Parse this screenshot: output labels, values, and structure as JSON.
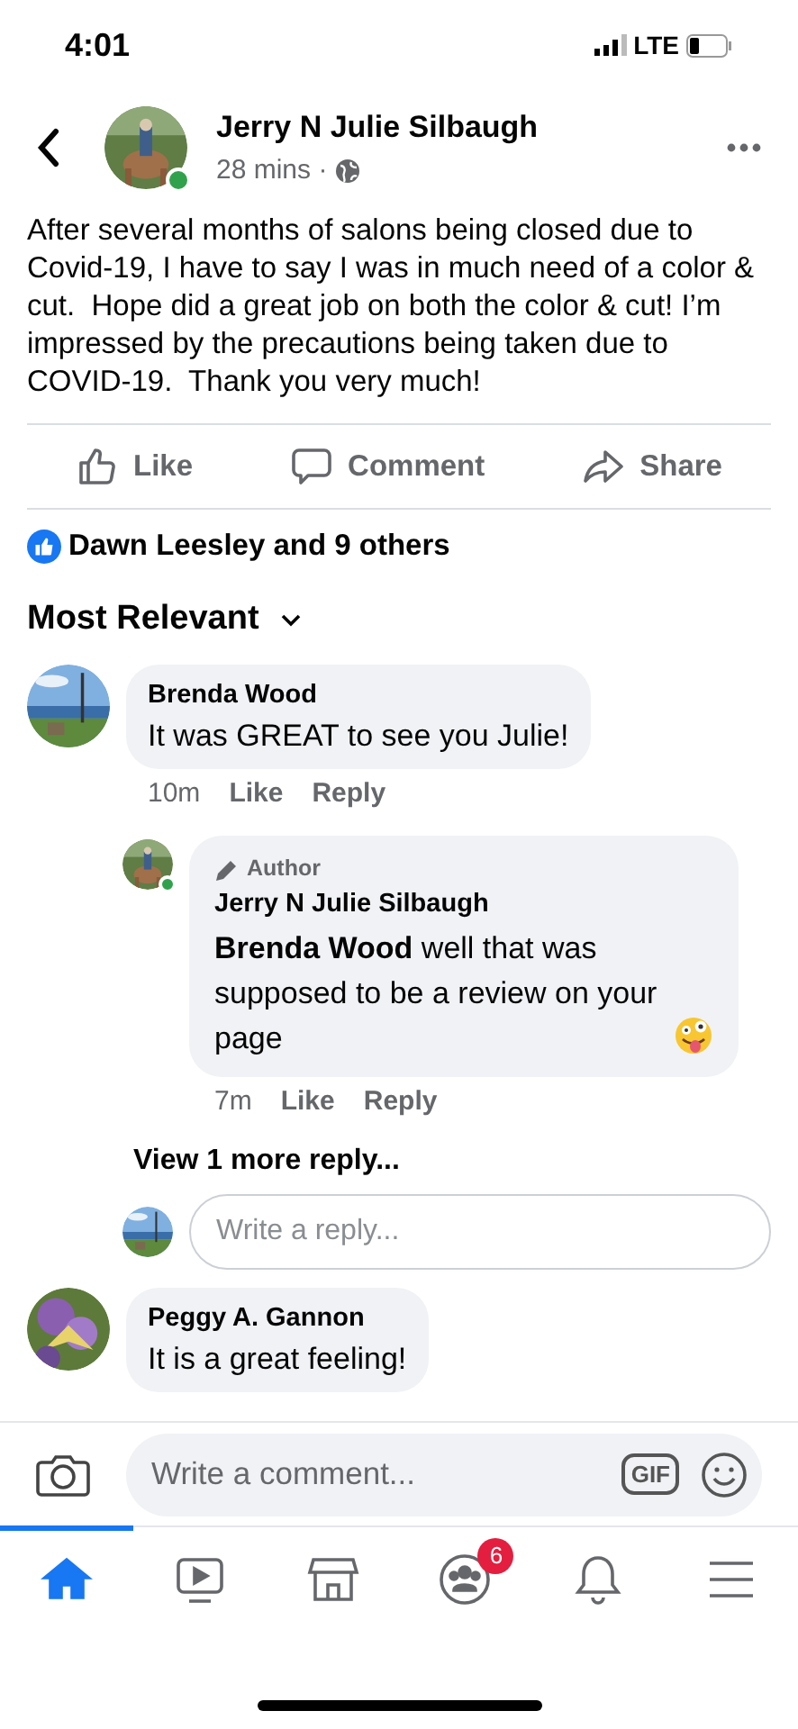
{
  "status_bar": {
    "time": "4:01",
    "network": "LTE"
  },
  "post": {
    "author": "Jerry N Julie Silbaugh",
    "online": true,
    "time": "28 mins ·",
    "body": "After several months of salons being closed due to Covid-19, I have to say I was in much need of a color & cut.  Hope did a great job on both the color & cut! I’m impressed by the precautions being taken due to COVID-19.  Thank you very much!"
  },
  "actions": [
    {
      "kind": "like",
      "label": "Like"
    },
    {
      "kind": "comment",
      "label": "Comment"
    },
    {
      "kind": "share",
      "label": "Share"
    }
  ],
  "reactions": "Dawn Leesley and 9 others",
  "sort": "Most Relevant",
  "comments": [
    {
      "author": "Brenda Wood",
      "text": "It was GREAT to see you Julie!",
      "time": "10m",
      "like": "Like",
      "reply": "Reply",
      "replies": [
        {
          "badge": "Author",
          "author": "Jerry N Julie Silbaugh",
          "online": true,
          "text": "**Brenda Wood** well that was supposed to be a review on your page",
          "time": "7m",
          "like": "Like",
          "reply": "Reply"
        }
      ],
      "more_replies": "View 1 more reply...",
      "reply_placeholder": "Write a reply..."
    },
    {
      "author": "Peggy A. Gannon",
      "text": "It is a great feeling!"
    }
  ],
  "comment_bar": {
    "placeholder": "Write a comment...",
    "gif": "GIF"
  },
  "tabs": [
    {
      "kind": "home",
      "selected": true
    },
    {
      "kind": "video",
      "selected": false
    },
    {
      "kind": "marketplace",
      "selected": false
    },
    {
      "kind": "groups",
      "selected": false,
      "badge": "6"
    },
    {
      "kind": "notifications",
      "selected": false
    },
    {
      "kind": "menu",
      "selected": false
    }
  ]
}
